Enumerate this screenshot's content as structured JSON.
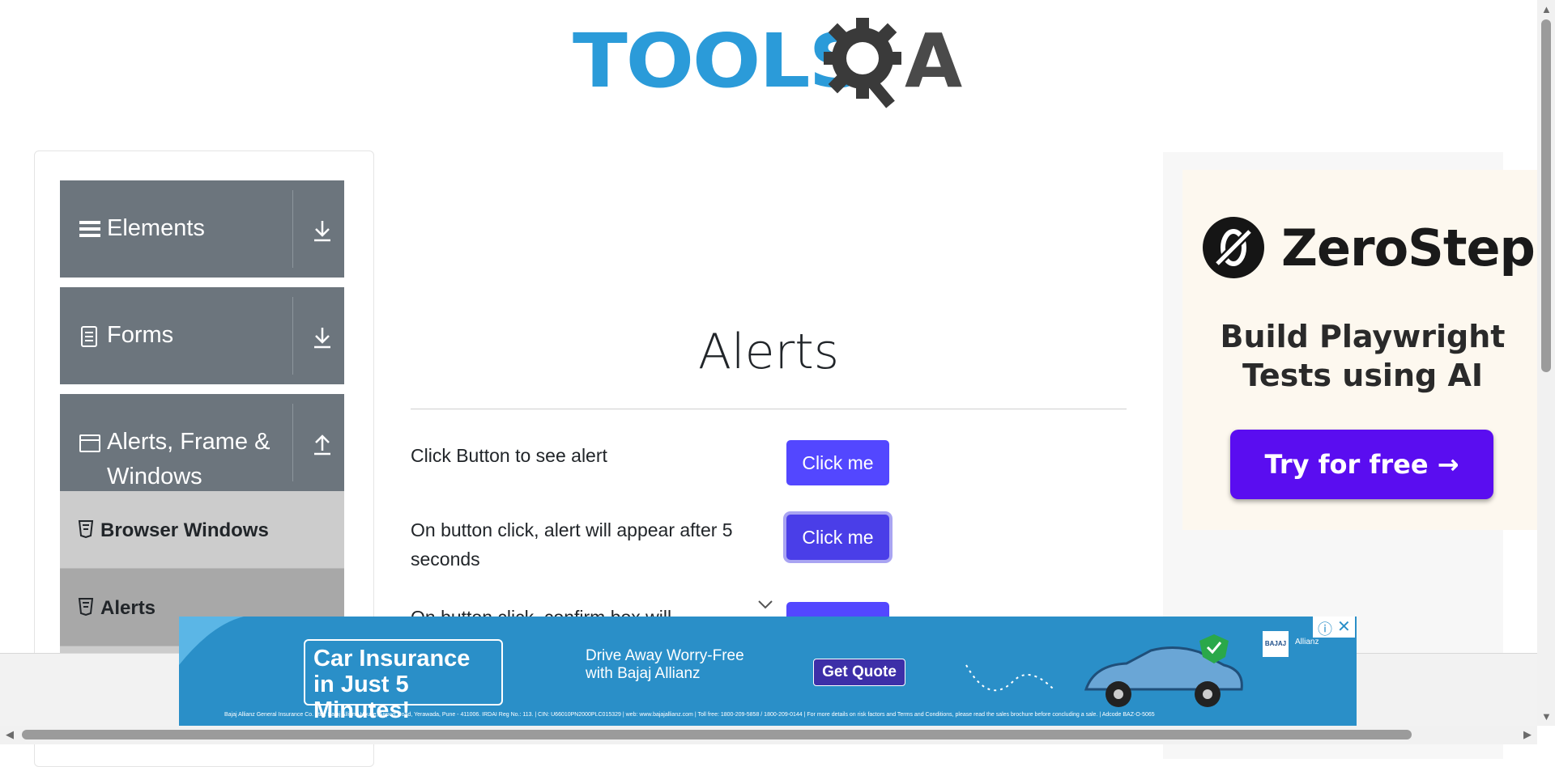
{
  "header": {
    "logo_text": "TOOLS",
    "logo_suffix": "A"
  },
  "sidebar": {
    "groups": [
      {
        "label": "Elements",
        "icon": "hamburger-icon",
        "state": "collapsed"
      },
      {
        "label": "Forms",
        "icon": "document-icon",
        "state": "collapsed"
      },
      {
        "label": "Alerts, Frame &",
        "label_line2": "Windows",
        "icon": "window-icon",
        "state": "expanded"
      }
    ],
    "items": [
      {
        "label": "Browser Windows",
        "icon": "html5-icon",
        "active": false
      },
      {
        "label": "Alerts",
        "icon": "html5-icon",
        "active": true
      }
    ]
  },
  "main": {
    "title": "Alerts",
    "rows": [
      {
        "label": "Click Button to see alert",
        "button": "Click me"
      },
      {
        "label": "On button click, alert will appear after 5 seconds",
        "button": "Click me"
      },
      {
        "label": "On button click, confirm box will",
        "button": ""
      }
    ]
  },
  "right_ad": {
    "brand": "ZeroStep",
    "tagline": "Build Playwright Tests using AI",
    "cta": "Try for free →",
    "colors": {
      "cta": "#5a0df0",
      "card": "#fdf8ef"
    }
  },
  "banner_ad": {
    "headline_1": "Car Insurance",
    "headline_2": "in Just 5 Minutes!",
    "sub_1": "Drive Away Worry-Free",
    "sub_2": "with Bajaj Allianz",
    "cta": "Get Quote",
    "brand_1": "BAJAJ",
    "brand_2": "Allianz",
    "fine_print": "Bajaj Allianz General Insurance Co. Ltd., Bajaj Allianz House, Airport Road, Yerawada, Pune - 411006. IRDAI Reg No.: 113. | CIN: U66010PN2000PLC015329 | web: www.bajajallianz.com | Toll free: 1800-209-5858 / 1800-209-0144 | For more details on risk factors and Terms and Conditions, please read the sales brochure before concluding a sale. | Adcode BAZ-O-5065",
    "color": "#2a8fc8"
  },
  "colors": {
    "primary_button": "#5347ff",
    "sidebar_header": "#6c757d",
    "logo_blue": "#2b9bd9"
  }
}
